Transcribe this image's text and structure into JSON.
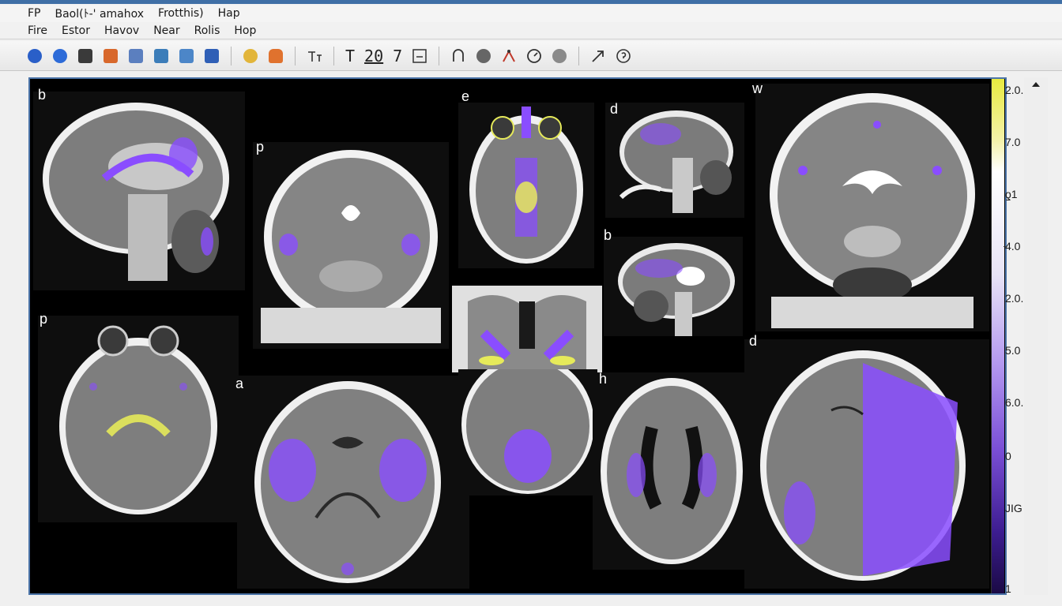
{
  "menus": {
    "top": [
      "FP",
      "Baol(ﾄ-' amahox",
      "Frotthis)",
      "Hap"
    ],
    "second": [
      "Fire",
      "Estor",
      "Havov",
      "Near",
      "Rolis",
      "Hop"
    ]
  },
  "toolbar": {
    "text_buttons": [
      "T",
      "20",
      "7"
    ]
  },
  "panel_labels": {
    "p1": "b",
    "p2": "p",
    "p3": "e",
    "p4": "d",
    "p5": "w",
    "p6": "b",
    "p7": "p",
    "p8": "a",
    "p9": "h",
    "p10": "d"
  },
  "colorbar": {
    "ticks": [
      "2.0.",
      "7.0",
      "ƍ1",
      "4.0",
      "2.0.",
      "5.0",
      "6.0.",
      "0",
      "JIG",
      "1"
    ],
    "colors": [
      "#e8ea40",
      "#ffffff",
      "#b59af0",
      "#7a4fd6",
      "#1a0a45"
    ]
  },
  "overlay_colors": {
    "purple": "#8a4dff",
    "yellow": "#e6ea5a"
  }
}
